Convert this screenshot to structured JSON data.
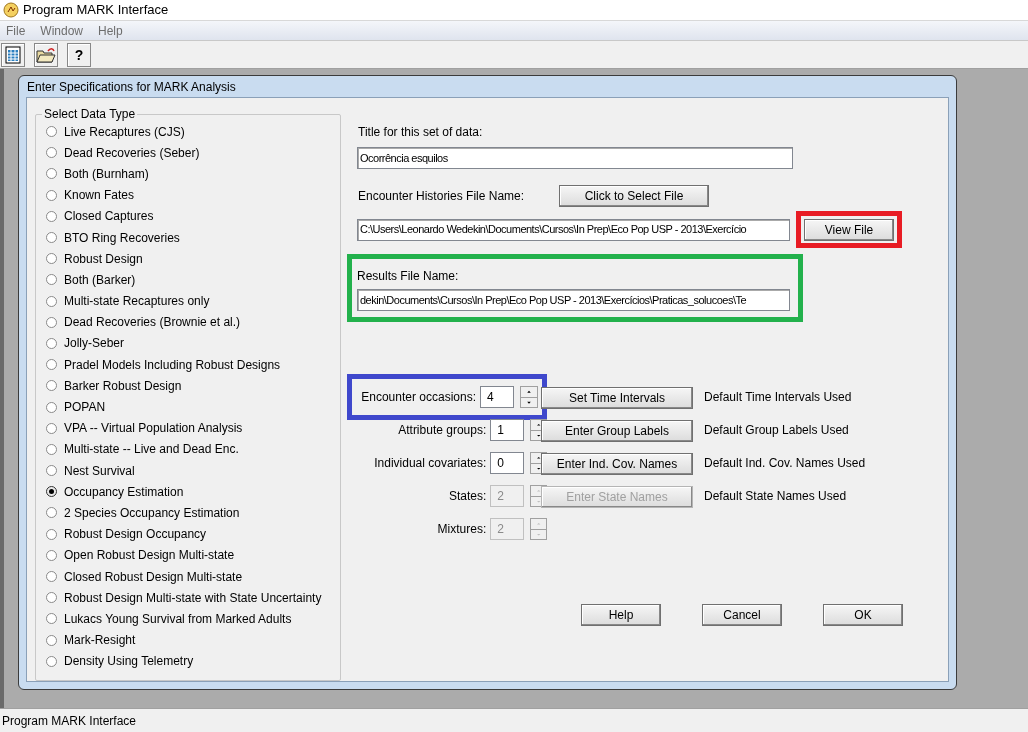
{
  "app": {
    "title": "Program MARK Interface",
    "menu": [
      "File",
      "Window",
      "Help"
    ],
    "toolbar": [
      {
        "kind": "sheet"
      },
      {
        "kind": "open"
      },
      {
        "kind": "help",
        "label": "?"
      }
    ]
  },
  "dialog": {
    "title": "Enter Specifications for MARK Analysis",
    "data_type": {
      "legend": "Select Data Type",
      "options": [
        {
          "label": "Live Recaptures (CJS)",
          "selected": false
        },
        {
          "label": "Dead Recoveries (Seber)",
          "selected": false
        },
        {
          "label": "Both (Burnham)",
          "selected": false
        },
        {
          "label": "Known Fates",
          "selected": false
        },
        {
          "label": "Closed Captures",
          "selected": false
        },
        {
          "label": "BTO Ring Recoveries",
          "selected": false
        },
        {
          "label": "Robust Design",
          "selected": false
        },
        {
          "label": "Both (Barker)",
          "selected": false
        },
        {
          "label": "Multi-state Recaptures only",
          "selected": false
        },
        {
          "label": "Dead Recoveries (Brownie et al.)",
          "selected": false
        },
        {
          "label": "Jolly-Seber",
          "selected": false
        },
        {
          "label": "Pradel Models Including Robust Designs",
          "selected": false
        },
        {
          "label": "Barker Robust Design",
          "selected": false
        },
        {
          "label": "POPAN",
          "selected": false
        },
        {
          "label": "VPA -- Virtual Population Analysis",
          "selected": false
        },
        {
          "label": "Multi-state -- Live and Dead Enc.",
          "selected": false
        },
        {
          "label": "Nest Survival",
          "selected": false
        },
        {
          "label": "Occupancy Estimation",
          "selected": true
        },
        {
          "label": "2 Species Occupancy Estimation",
          "selected": false
        },
        {
          "label": "Robust Design Occupancy",
          "selected": false
        },
        {
          "label": "Open Robust Design Multi-state",
          "selected": false
        },
        {
          "label": "Closed Robust Design Multi-state",
          "selected": false
        },
        {
          "label": "Robust Design Multi-state with State Uncertainty",
          "selected": false
        },
        {
          "label": "Lukacs Young Survival from Marked Adults",
          "selected": false
        },
        {
          "label": "Mark-Resight",
          "selected": false
        },
        {
          "label": "Density Using Telemetry",
          "selected": false
        }
      ]
    },
    "title_field": {
      "label": "Title for this set of data:",
      "value": "Ocorrência esquilos"
    },
    "histories_file": {
      "label": "Encounter Histories File Name:",
      "select_button": "Click to Select File",
      "value": "C:\\Users\\Leonardo Wedekin\\Documents\\Cursos\\In Prep\\Eco Pop USP - 2013\\Exercício",
      "view_button": "View File"
    },
    "results_file": {
      "label": "Results File Name:",
      "value": "dekin\\Documents\\Cursos\\In Prep\\Eco Pop USP - 2013\\Exercícios\\Praticas_solucoes\\Te"
    },
    "counts": [
      {
        "label": "Encounter occasions:",
        "value": "4",
        "disabled": false,
        "button": "Set Time Intervals",
        "status": "Default Time Intervals Used",
        "annotated": true
      },
      {
        "label": "Attribute groups:",
        "value": "1",
        "disabled": false,
        "button": "Enter Group Labels",
        "status": "Default Group Labels Used",
        "annotated": false
      },
      {
        "label": "Individual covariates:",
        "value": "0",
        "disabled": false,
        "button": "Enter Ind. Cov. Names",
        "status": "Default Ind. Cov. Names Used",
        "annotated": false
      },
      {
        "label": "States:",
        "value": "2",
        "disabled": true,
        "button": "Enter State Names",
        "status": "Default State Names Used",
        "annotated": false
      },
      {
        "label": "Mixtures:",
        "value": "2",
        "disabled": true,
        "annotated": false
      }
    ],
    "buttons": [
      "Help",
      "Cancel",
      "OK"
    ]
  },
  "status_bar": "Program MARK Interface"
}
